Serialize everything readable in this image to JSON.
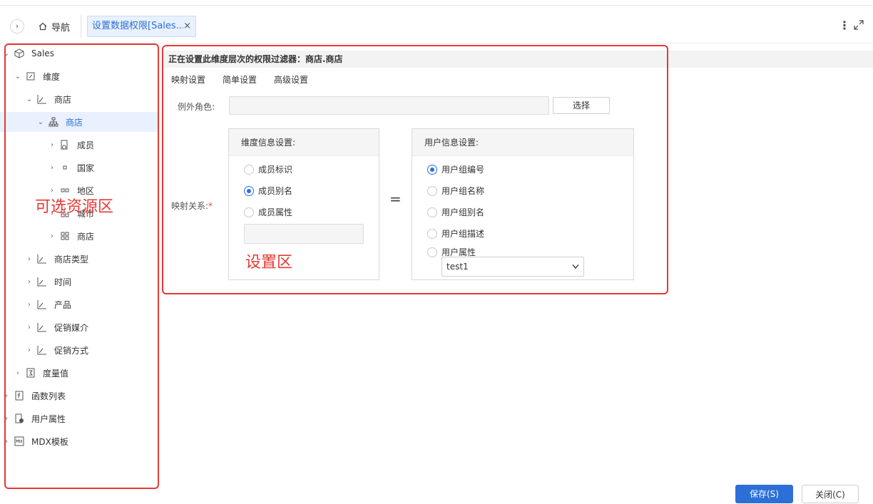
{
  "tabs": {
    "nav_label": "导航",
    "active_label": "设置数据权限[Sales...",
    "close_symbol": "×"
  },
  "tree": {
    "items": [
      {
        "label": "Sales"
      },
      {
        "label": "维度"
      },
      {
        "label": "商店"
      },
      {
        "label": "商店"
      },
      {
        "label": "成员"
      },
      {
        "label": "国家"
      },
      {
        "label": "地区"
      },
      {
        "label": "城市"
      },
      {
        "label": "商店"
      },
      {
        "label": "商店类型"
      },
      {
        "label": "时间"
      },
      {
        "label": "产品"
      },
      {
        "label": "促销媒介"
      },
      {
        "label": "促销方式"
      },
      {
        "label": "度量值"
      },
      {
        "label": "函数列表"
      },
      {
        "label": "用户属性"
      },
      {
        "label": "MDX模板"
      }
    ]
  },
  "panel": {
    "header": "正在设置此维度层次的权限过滤器：商店.商店",
    "subtabs": [
      "映射设置",
      "简单设置",
      "高级设置"
    ],
    "exception_role_label": "例外角色:",
    "choose_button": "选择",
    "mapping_label": "映射关系:",
    "required_mark": "*",
    "equals": "="
  },
  "dimension_box": {
    "title": "维度信息设置:",
    "options": [
      {
        "label": "成员标识",
        "checked": false
      },
      {
        "label": "成员别名",
        "checked": true
      },
      {
        "label": "成员属性",
        "checked": false
      }
    ]
  },
  "user_box": {
    "title": "用户信息设置:",
    "options": [
      {
        "label": "用户组编号",
        "checked": true
      },
      {
        "label": "用户组名称",
        "checked": false
      },
      {
        "label": "用户组别名",
        "checked": false
      },
      {
        "label": "用户组描述",
        "checked": false
      },
      {
        "label": "用户属性",
        "checked": false
      }
    ],
    "select_value": "test1"
  },
  "annotations": {
    "resource_area": "可选资源区",
    "settings_area": "设置区",
    "color": "#e53935"
  },
  "footer": {
    "save_label": "保存(S)",
    "close_label": "关闭(C)"
  },
  "colors": {
    "accent": "#2c6fd6",
    "selected_bg": "#e8f1fd"
  }
}
